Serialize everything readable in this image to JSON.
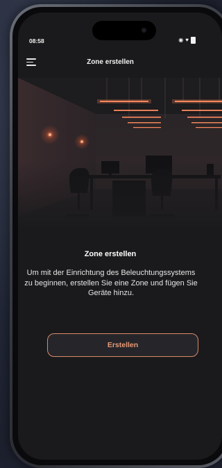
{
  "status_bar": {
    "time": "08:58",
    "icons": [
      "eye-icon",
      "wifi-icon",
      "battery-icon"
    ]
  },
  "header": {
    "menu_icon": "hamburger-menu-icon",
    "title": "Zone erstellen"
  },
  "hero": {
    "illustration": "dark-office-illustration"
  },
  "content": {
    "title": "Zone erstellen",
    "body": "Um mit der Einrichtung des Beleuchtungssystems zu beginnen, erstellen Sie eine Zone und fügen Sie Geräte hinzu."
  },
  "actions": {
    "create_label": "Erstellen"
  },
  "colors": {
    "accent": "#e99a78",
    "accent_border": "#d9896a",
    "screen_bg": "#1a1a1c",
    "light_glow": "#ff7a4a"
  }
}
